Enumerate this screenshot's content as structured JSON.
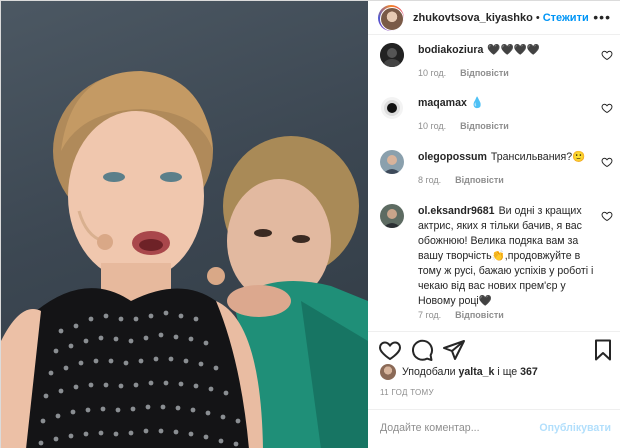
{
  "header": {
    "username": "zhukovtsova_kiyashko",
    "dot": "•",
    "follow_label": "Стежити",
    "more_label": "•••"
  },
  "comments": [
    {
      "username": "bodiakoziura",
      "text": "🖤🖤🖤🖤",
      "time": "10 год.",
      "reply_label": "Відповісти",
      "avatar_icon": "user-avatar-dark"
    },
    {
      "username": "maqamax",
      "text": "💧",
      "time": "10 год.",
      "reply_label": "Відповісти",
      "avatar_icon": "user-avatar-orb"
    },
    {
      "username": "olegopossum",
      "text": "Трансильвания?🙂",
      "time": "8 год.",
      "reply_label": "Відповісти",
      "avatar_icon": "user-avatar-photo"
    },
    {
      "username": "ol.eksandr9681",
      "text": "Ви одні з кращих актрис, яких я тільки бачив, я вас обожнюю! Велика подяка вам за вашу творчість👏,продовжуйте в тому ж русі, бажаю успіхів у роботі і чекаю від вас нових прем'єр у Новому році🖤",
      "time": "7 год.",
      "reply_label": "Відповісти",
      "avatar_icon": "user-avatar-photo"
    }
  ],
  "likes": {
    "prefix": "Уподобали",
    "user": "yalta_k",
    "suffix": "і ще",
    "count": "367"
  },
  "timestamp": "11 ГОД ТОМУ",
  "add_comment": {
    "placeholder": "Додайте коментар...",
    "publish_label": "Опублікувати"
  },
  "colors": {
    "accent": "#0095f6",
    "publish_disabled": "#b2dffc",
    "muted": "#8e8e8e"
  }
}
